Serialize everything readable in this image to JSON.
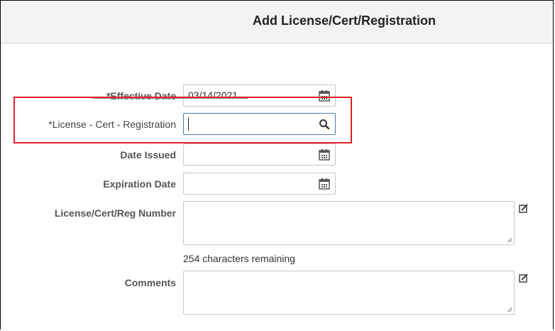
{
  "dialog": {
    "title": "Add License/Cert/Registration"
  },
  "form": {
    "effective_date_label": "*Effective Date",
    "effective_date_value": "03/14/2021",
    "license_label": "*License - Cert - Registration",
    "license_value": "",
    "date_issued_label": "Date Issued",
    "date_issued_value": "",
    "expiration_date_label": "Expiration Date",
    "expiration_date_value": "",
    "number_label": "License/Cert/Reg Number",
    "number_value": "",
    "counter_text": "254 characters remaining",
    "comments_label": "Comments",
    "comments_value": ""
  },
  "icons": {
    "calendar": "calendar-icon",
    "search": "search-icon",
    "edit": "edit-icon"
  },
  "colors": {
    "highlight": "#e21f26",
    "focus": "#4a7bb7"
  }
}
